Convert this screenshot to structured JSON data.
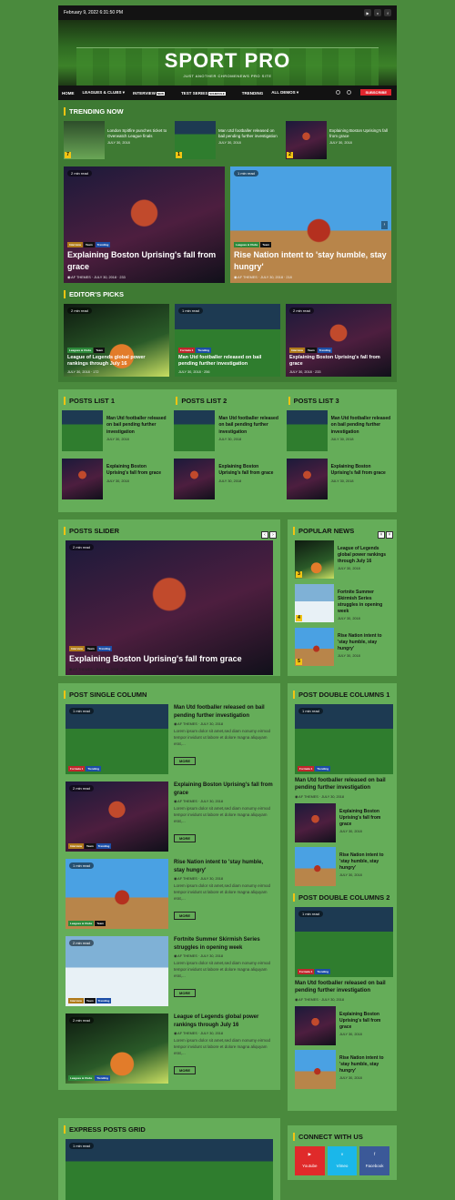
{
  "topbar": {
    "date": "February 9, 2022 6:31:50 PM"
  },
  "header": {
    "title": "SPORT PRO",
    "tagline": "JUST ANOTHER CHROMENEWS PRO SITE"
  },
  "nav": {
    "items": [
      "HOME",
      "LEAGUES & CLUBS ▾",
      "INTERVIEW",
      "TEST SERIES",
      "TRENDING",
      "ALL DEMOS ▾"
    ],
    "interview_badge": "NEW",
    "test_badge": "SCHEDULE",
    "subscribe": "SUBSCRIBE"
  },
  "trending": {
    "title": "TRENDING NOW",
    "items": [
      {
        "num": "7",
        "title": "London Spitfire punches ticket to Overwatch League finals",
        "date": "JULY 30, 2018"
      },
      {
        "num": "1",
        "title": "Man Utd footballer released on bail pending further investigation",
        "date": "JULY 30, 2018"
      },
      {
        "num": "2",
        "title": "Explaining Boston Uprising's fall from grace",
        "date": "JULY 30, 2018"
      }
    ]
  },
  "featured": [
    {
      "read": "2 min read",
      "title": "Explaining Boston Uprising's fall from grace",
      "author": "AF THEMES",
      "date": "JULY 30, 2018",
      "views": "233",
      "tags": [
        "Interview",
        "Team",
        "Trending"
      ]
    },
    {
      "read": "1 min read",
      "title": "Rise Nation intent to 'stay humble, stay hungry'",
      "author": "AF THEMES",
      "date": "JULY 30, 2018",
      "views": "218",
      "tags": [
        "Leagues & Clubs",
        "Team"
      ]
    }
  ],
  "editors": {
    "title": "EDITOR'S PICKS",
    "items": [
      {
        "read": "2 min read",
        "title": "League of Legends global power rankings through July 16",
        "date": "JULY 30, 2018",
        "views": "172",
        "tags": [
          "Leagues & Clubs",
          "Team"
        ]
      },
      {
        "read": "1 min read",
        "title": "Man Utd footballer released on bail pending further investigation",
        "date": "JULY 30, 2018",
        "views": "256",
        "tags": [
          "Formula 1",
          "Trending"
        ]
      },
      {
        "read": "2 min read",
        "title": "Explaining Boston Uprising's fall from grace",
        "date": "JULY 30, 2018",
        "views": "233",
        "tags": [
          "Interview",
          "Team",
          "Trending"
        ]
      }
    ]
  },
  "lists": [
    {
      "title": "POSTS LIST 1",
      "items": [
        {
          "title": "Man Utd footballer released on bail pending further investigation",
          "date": "JULY 30, 2018"
        },
        {
          "title": "Explaining Boston Uprising's fall from grace",
          "date": "JULY 30, 2018"
        }
      ]
    },
    {
      "title": "POSTS LIST 2",
      "items": [
        {
          "title": "Man Utd footballer released on bail pending further investigation",
          "date": "JULY 30, 2018"
        },
        {
          "title": "Explaining Boston Uprising's fall from grace",
          "date": "JULY 30, 2018"
        }
      ]
    },
    {
      "title": "POSTS LIST 3",
      "items": [
        {
          "title": "Man Utd footballer released on bail pending further investigation",
          "date": "JULY 30, 2018"
        },
        {
          "title": "Explaining Boston Uprising's fall from grace",
          "date": "JULY 30, 2018"
        }
      ]
    }
  ],
  "slider": {
    "title": "POSTS SLIDER",
    "read": "2 min read",
    "post_title": "Explaining Boston Uprising's fall from grace",
    "author": "AF THEMES",
    "date": "JULY 30, 2018",
    "views": "233",
    "tags": [
      "Interview",
      "Team",
      "Trending"
    ]
  },
  "popular": {
    "title": "POPULAR NEWS",
    "items": [
      {
        "num": "3",
        "title": "League of Legends global power rankings through July 16",
        "date": "JULY 30, 2018"
      },
      {
        "num": "4",
        "title": "Fortnite Summer Skirmish Series struggles in opening week",
        "date": "JULY 30, 2018"
      },
      {
        "num": "5",
        "title": "Rise Nation intent to 'stay humble, stay hungry'",
        "date": "JULY 30, 2018"
      }
    ]
  },
  "single": {
    "title": "POST SINGLE COLUMN",
    "excerpt": "Lorem ipsum dolor sit amet,sed diam nonumy eirmod tempor invidunt ut labore et dolore magna aliquyam erat,...",
    "more": "MORE",
    "items": [
      {
        "read": "1 min read",
        "title": "Man Utd footballer released on bail pending further investigation",
        "author": "AF THEMES",
        "date": "JULY 30, 2018",
        "tags": [
          "Formula 1",
          "Trending"
        ]
      },
      {
        "read": "2 min read",
        "title": "Explaining Boston Uprising's fall from grace",
        "author": "AF THEMES",
        "date": "JULY 30, 2018",
        "tags": [
          "Interview",
          "Team",
          "Trending"
        ]
      },
      {
        "read": "1 min read",
        "title": "Rise Nation intent to 'stay humble, stay hungry'",
        "author": "AF THEMES",
        "date": "JULY 30, 2018",
        "tags": [
          "Leagues & Clubs",
          "Team"
        ]
      },
      {
        "read": "2 min read",
        "title": "Fortnite Summer Skirmish Series struggles in opening week",
        "author": "AF THEMES",
        "date": "JULY 30, 2018",
        "tags": [
          "Interview",
          "Team",
          "Trending"
        ]
      },
      {
        "read": "2 min read",
        "title": "League of Legends global power rankings through July 16",
        "author": "AF THEMES",
        "date": "JULY 30, 2018",
        "tags": [
          "Leagues & Clubs",
          "Trending"
        ]
      }
    ]
  },
  "double1": {
    "title": "POST DOUBLE COLUMNS 1",
    "main": {
      "read": "1 min read",
      "title": "Man Utd footballer released on bail pending further investigation",
      "author": "AF THEMES",
      "date": "JULY 30, 2018",
      "tags": [
        "Formula 1",
        "Trending"
      ]
    },
    "items": [
      {
        "title": "Explaining Boston Uprising's fall from grace",
        "date": "JULY 30, 2018"
      },
      {
        "title": "Rise Nation intent to 'stay humble, stay hungry'",
        "date": "JULY 30, 2018"
      }
    ]
  },
  "double2": {
    "title": "POST DOUBLE COLUMNS 2",
    "main": {
      "read": "1 min read",
      "title": "Man Utd footballer released on bail pending further investigation",
      "author": "AF THEMES",
      "date": "JULY 30, 2018",
      "tags": [
        "Formula 1",
        "Trending"
      ]
    },
    "items": [
      {
        "title": "Explaining Boston Uprising's fall from grace",
        "date": "JULY 30, 2018"
      },
      {
        "title": "Rise Nation intent to 'stay humble, stay hungry'",
        "date": "JULY 30, 2018"
      }
    ]
  },
  "express": {
    "title": "EXPRESS POSTS GRID",
    "read": "1 min read"
  },
  "connect": {
    "title": "CONNECT WITH US",
    "items": [
      {
        "label": "Youtube",
        "color": "#e02a2a"
      },
      {
        "label": "Vimeo",
        "color": "#1ab7ea"
      },
      {
        "label": "Facebook",
        "color": "#3b5998"
      }
    ]
  }
}
